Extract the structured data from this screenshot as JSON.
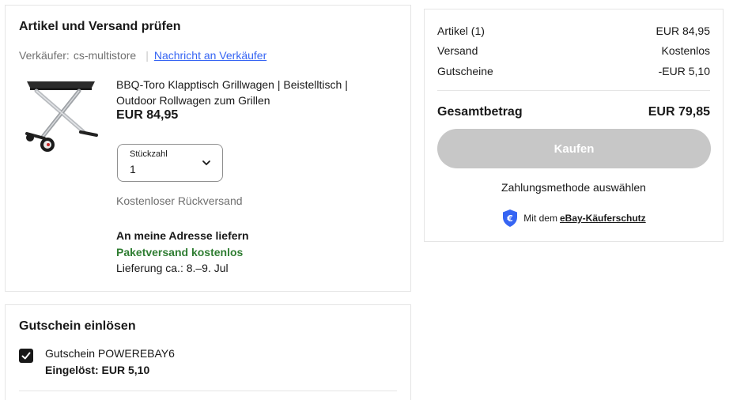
{
  "items_section": {
    "title": "Artikel und Versand prüfen",
    "seller_label": "Verkäufer:",
    "seller_name": "cs-multistore",
    "message_link": "Nachricht an Verkäufer",
    "product": {
      "image_icon": "folding-grill-cart-image",
      "title": "BBQ-Toro Klapptisch Grillwagen | Beistelltisch | Outdoor Rollwagen zum Grillen",
      "price": "EUR 84,95",
      "quantity_label": "Stückzahl",
      "quantity_value": "1",
      "returns": "Kostenloser Rückversand",
      "delivery_heading": "An meine Adresse liefern",
      "shipping": "Paketversand kostenlos",
      "delivery_estimate": "Lieferung ca.: 8.–9. Jul"
    }
  },
  "summary": {
    "rows": [
      {
        "label": "Artikel (1)",
        "value": "EUR 84,95"
      },
      {
        "label": "Versand",
        "value": "Kostenlos"
      },
      {
        "label": "Gutscheine",
        "value": "-EUR 5,10"
      }
    ],
    "total_label": "Gesamtbetrag",
    "total_value": "EUR 79,85",
    "buy_button": "Kaufen",
    "payment_method": "Zahlungsmethode auswählen",
    "protection_prefix": "Mit dem",
    "protection_link": "eBay-Käuferschutz"
  },
  "coupon_section": {
    "title": "Gutschein einlösen",
    "checked": true,
    "code_text": "Gutschein POWEREBAY6",
    "applied_text": "Eingelöst: EUR 5,10"
  },
  "colors": {
    "link": "#3665f3",
    "success": "#2f7d32",
    "button_disabled": "#c7c7c7",
    "shield": "#3665f3"
  }
}
